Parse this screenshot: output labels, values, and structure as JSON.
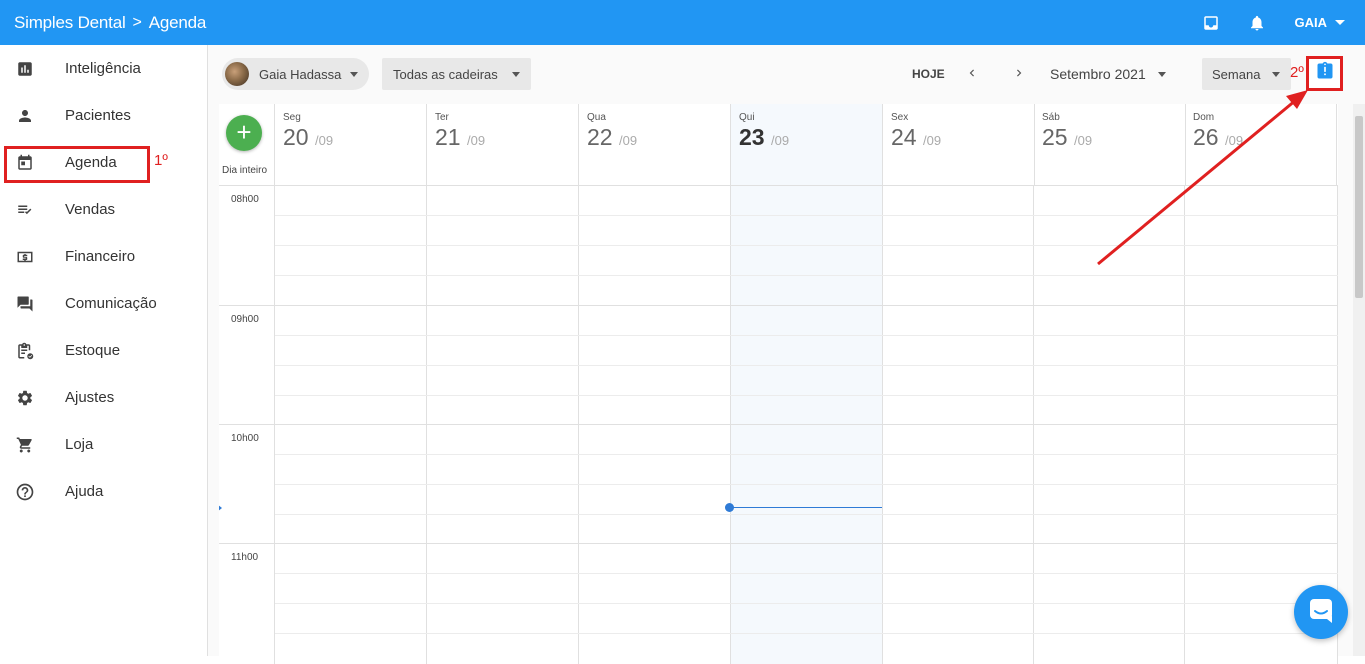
{
  "header": {
    "app_name": "Simples Dental",
    "separator": ">",
    "page": "Agenda",
    "user": "GAIA"
  },
  "sidebar": {
    "items": [
      {
        "label": "Inteligência",
        "icon": "bar-chart-icon"
      },
      {
        "label": "Pacientes",
        "icon": "person-icon"
      },
      {
        "label": "Agenda",
        "icon": "calendar-icon"
      },
      {
        "label": "Vendas",
        "icon": "list-check-icon"
      },
      {
        "label": "Financeiro",
        "icon": "money-icon"
      },
      {
        "label": "Comunicação",
        "icon": "chat-icon"
      },
      {
        "label": "Estoque",
        "icon": "clipboard-icon"
      },
      {
        "label": "Ajustes",
        "icon": "gear-icon"
      },
      {
        "label": "Loja",
        "icon": "cart-icon"
      },
      {
        "label": "Ajuda",
        "icon": "help-icon"
      }
    ],
    "annotation": "1º"
  },
  "toolbar": {
    "professional": "Gaia Hadassa",
    "chairs": "Todas as cadeiras",
    "today": "HOJE",
    "month": "Setembro 2021",
    "view": "Semana",
    "annotation": "2º"
  },
  "calendar": {
    "add_label": "+",
    "all_day": "Dia inteiro",
    "days": [
      {
        "name": "Seg",
        "num": "20",
        "month": "/09"
      },
      {
        "name": "Ter",
        "num": "21",
        "month": "/09"
      },
      {
        "name": "Qua",
        "num": "22",
        "month": "/09"
      },
      {
        "name": "Qui",
        "num": "23",
        "month": "/09"
      },
      {
        "name": "Sex",
        "num": "24",
        "month": "/09"
      },
      {
        "name": "Sáb",
        "num": "25",
        "month": "/09"
      },
      {
        "name": "Dom",
        "num": "26",
        "month": "/09"
      }
    ],
    "hours": [
      "08h00",
      "09h00",
      "10h00",
      "11h00"
    ]
  },
  "colors": {
    "primary": "#2196f3",
    "add": "#4caf50",
    "annotation": "#e02020",
    "now_line": "#2f7bd6"
  }
}
